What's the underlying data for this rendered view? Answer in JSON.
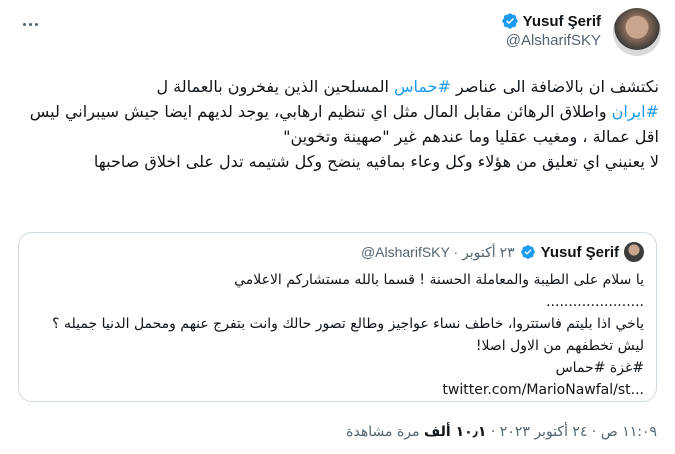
{
  "header": {
    "display_name": "Yusuf Şerif",
    "handle": "@AlsharifSKY",
    "verified_icon": "verified-badge-icon",
    "more_icon": "more-dots-icon"
  },
  "tweet": {
    "line1": "نكتشف ان بالاضافة الى عناصر ",
    "line1_tag": "#حماس",
    "line1_rest": " المسلحين الذين يفخرون بالعمالة ل",
    "line2_tag": "#ايران",
    "line2_rest": " واطلاق الرهائن مقابل المال مثل اي تنظيم ارهابي، يوجد لديهم ايضا جيش سيبراني ليس اقل عمالة ، ومغيب عقليا وما عندهم غير \"صهينة وتخوين\"",
    "line3": "لا يعنيني اي تعليق من هؤلاء وكل وعاء بمافيه ينضح وكل شتيمه تدل على اخلاق صاحبها"
  },
  "quote": {
    "display_name": "Yusuf Şerif",
    "meta": "@AlsharifSKY · ٢٣ أكتوبر",
    "line1": "يا سلام على الطيبة والمعاملة الحسنة ! قسما بالله مستشاركم الاعلامي",
    "dots": "......................",
    "line2": "ياخي اذا بليتم فاستتروا، خاطف نساء عواجيز  وطالع تصور حالك وانت بتفرج عنهم ومحمل الدنيا جميله ؟ ليش تخطفهم من الاول اصلا!",
    "tags": "#غزة #حماس ",
    "link": "twitter.com/MarioNawfal/st..."
  },
  "footer": {
    "time": "١١:٠٩ ص · ٢٤ أكتوبر ٢٠٢٣ · ",
    "views_count": "١٠٫١ ألف",
    "views_label": " مرة مشاهدة"
  }
}
